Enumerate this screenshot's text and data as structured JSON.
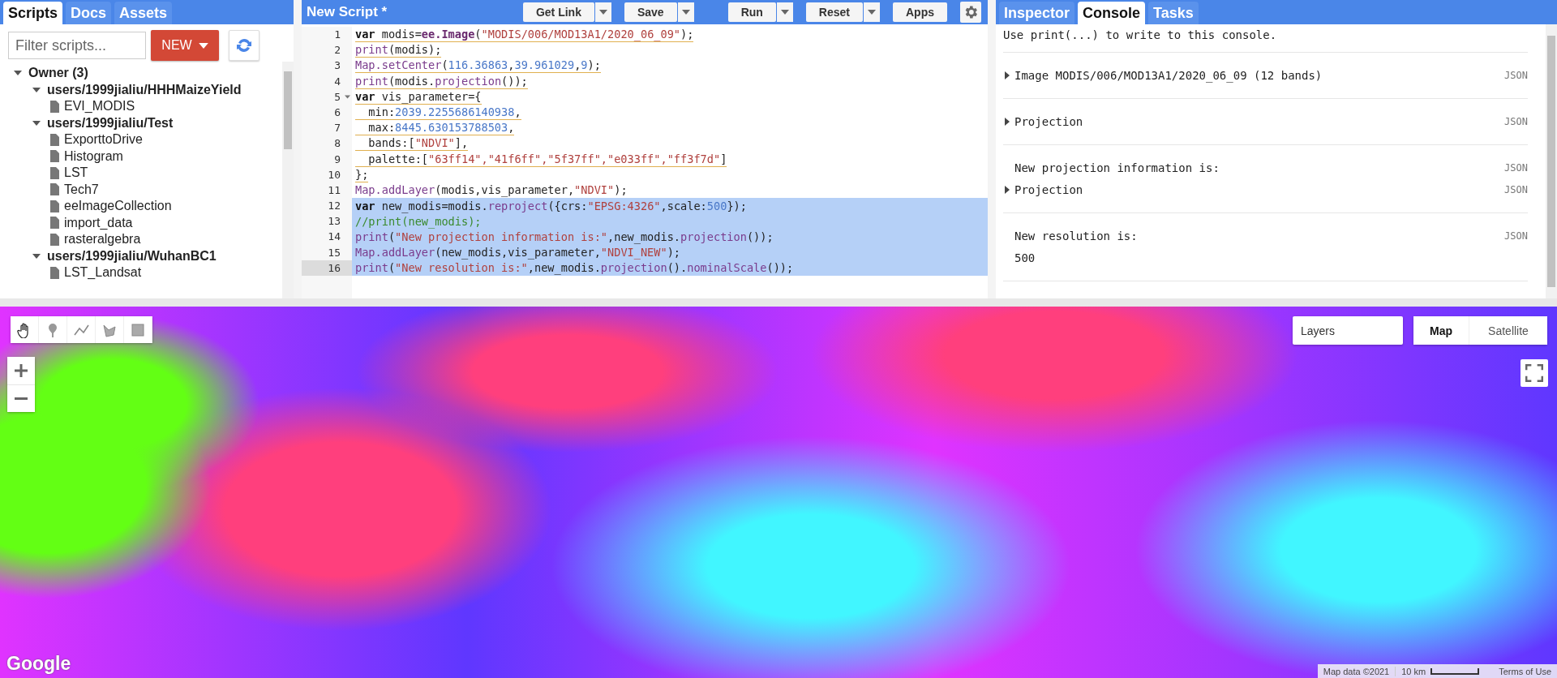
{
  "left_panel": {
    "tabs": [
      {
        "label": "Scripts",
        "selected": true
      },
      {
        "label": "Docs",
        "selected": false
      },
      {
        "label": "Assets",
        "selected": false
      }
    ],
    "filter": {
      "placeholder": "Filter scripts..."
    },
    "new_button": {
      "label": "NEW"
    },
    "tree": [
      {
        "label": "Owner (3)",
        "kind": "group",
        "expanded": true,
        "children": [
          {
            "label": "users/1999jialiu/HHHMaizeYield",
            "kind": "repo",
            "expanded": true,
            "children": [
              {
                "label": "EVI_MODIS",
                "kind": "file"
              }
            ]
          },
          {
            "label": "users/1999jialiu/Test",
            "kind": "repo",
            "expanded": true,
            "children": [
              {
                "label": "ExporttoDrive",
                "kind": "file"
              },
              {
                "label": "Histogram",
                "kind": "file"
              },
              {
                "label": "LST",
                "kind": "file"
              },
              {
                "label": "Tech7",
                "kind": "file"
              },
              {
                "label": "eeImageCollection",
                "kind": "file"
              },
              {
                "label": "import_data",
                "kind": "file"
              },
              {
                "label": "rasteralgebra",
                "kind": "file"
              }
            ]
          },
          {
            "label": "users/1999jialiu/WuhanBC1",
            "kind": "repo",
            "expanded": true,
            "children": [
              {
                "label": "LST_Landsat",
                "kind": "file"
              }
            ]
          }
        ]
      }
    ]
  },
  "editor": {
    "title": "New Script *",
    "buttons": [
      {
        "label": "Get Link",
        "dropdown": true
      },
      {
        "label": "Save",
        "dropdown": true
      },
      {
        "label": "Run",
        "dropdown": true
      },
      {
        "label": "Reset",
        "dropdown": true
      },
      {
        "label": "Apps",
        "dropdown": false
      }
    ],
    "lines": [
      {
        "number": "1",
        "selected": false,
        "current": false,
        "warning": true,
        "fold": false,
        "tokens": [
          {
            "kind": "keyword",
            "text": "var"
          },
          {
            "kind": "plain",
            "text": " modis="
          },
          {
            "kind": "call",
            "text": "ee.Image"
          },
          {
            "kind": "plain",
            "text": "("
          },
          {
            "kind": "string",
            "text": "\"MODIS/006/MOD13A1/2020_06_09\""
          },
          {
            "kind": "plain",
            "text": ");"
          }
        ]
      },
      {
        "number": "2",
        "selected": false,
        "current": false,
        "warning": true,
        "fold": false,
        "tokens": [
          {
            "kind": "func",
            "text": "print"
          },
          {
            "kind": "plain",
            "text": "(modis);"
          }
        ]
      },
      {
        "number": "3",
        "selected": false,
        "current": false,
        "warning": true,
        "fold": false,
        "tokens": [
          {
            "kind": "func",
            "text": "Map.setCenter"
          },
          {
            "kind": "plain",
            "text": "("
          },
          {
            "kind": "number",
            "text": "116.36863"
          },
          {
            "kind": "plain",
            "text": ","
          },
          {
            "kind": "number",
            "text": "39.961029"
          },
          {
            "kind": "plain",
            "text": ","
          },
          {
            "kind": "number",
            "text": "9"
          },
          {
            "kind": "plain",
            "text": ");"
          }
        ]
      },
      {
        "number": "4",
        "selected": false,
        "current": false,
        "warning": true,
        "fold": false,
        "tokens": [
          {
            "kind": "func",
            "text": "print"
          },
          {
            "kind": "plain",
            "text": "(modis."
          },
          {
            "kind": "func",
            "text": "projection"
          },
          {
            "kind": "plain",
            "text": "());"
          }
        ]
      },
      {
        "number": "5",
        "selected": false,
        "current": false,
        "warning": true,
        "fold": true,
        "tokens": [
          {
            "kind": "keyword",
            "text": "var"
          },
          {
            "kind": "plain",
            "text": " vis_parameter={"
          }
        ]
      },
      {
        "number": "6",
        "selected": false,
        "current": false,
        "warning": true,
        "fold": false,
        "tokens": [
          {
            "kind": "plain",
            "text": "  min:"
          },
          {
            "kind": "number",
            "text": "2039.2255686140938"
          },
          {
            "kind": "plain",
            "text": ","
          }
        ]
      },
      {
        "number": "7",
        "selected": false,
        "current": false,
        "warning": true,
        "fold": false,
        "tokens": [
          {
            "kind": "plain",
            "text": "  max:"
          },
          {
            "kind": "number",
            "text": "8445.630153788503"
          },
          {
            "kind": "plain",
            "text": ","
          }
        ]
      },
      {
        "number": "8",
        "selected": false,
        "current": false,
        "warning": true,
        "fold": false,
        "tokens": [
          {
            "kind": "plain",
            "text": "  bands:["
          },
          {
            "kind": "string",
            "text": "\"NDVI\""
          },
          {
            "kind": "plain",
            "text": "],"
          }
        ]
      },
      {
        "number": "9",
        "selected": false,
        "current": false,
        "warning": true,
        "fold": false,
        "tokens": [
          {
            "kind": "plain",
            "text": "  palette:["
          },
          {
            "kind": "string",
            "text": "\"63ff14\",\"41f6ff\",\"5f37ff\",\"e033ff\",\"ff3f7d\""
          },
          {
            "kind": "plain",
            "text": "]"
          }
        ]
      },
      {
        "number": "10",
        "selected": false,
        "current": false,
        "warning": true,
        "fold": false,
        "tokens": [
          {
            "kind": "plain",
            "text": "};"
          }
        ]
      },
      {
        "number": "11",
        "selected": false,
        "current": false,
        "warning": false,
        "fold": false,
        "tokens": [
          {
            "kind": "func",
            "text": "Map.addLayer"
          },
          {
            "kind": "plain",
            "text": "(modis,vis_parameter,"
          },
          {
            "kind": "string",
            "text": "\"NDVI\""
          },
          {
            "kind": "plain",
            "text": ");"
          }
        ]
      },
      {
        "number": "12",
        "selected": true,
        "current": false,
        "warning": false,
        "fold": false,
        "tokens": [
          {
            "kind": "keyword",
            "text": "var"
          },
          {
            "kind": "plain",
            "text": " new_modis=modis."
          },
          {
            "kind": "func",
            "text": "reproject"
          },
          {
            "kind": "plain",
            "text": "({crs:"
          },
          {
            "kind": "string",
            "text": "\"EPSG:4326\""
          },
          {
            "kind": "plain",
            "text": ",scale:"
          },
          {
            "kind": "number",
            "text": "500"
          },
          {
            "kind": "plain",
            "text": "});"
          }
        ]
      },
      {
        "number": "13",
        "selected": true,
        "current": false,
        "warning": false,
        "fold": false,
        "tokens": [
          {
            "kind": "comment",
            "text": "//print(new_modis);"
          }
        ]
      },
      {
        "number": "14",
        "selected": true,
        "current": false,
        "warning": false,
        "fold": false,
        "tokens": [
          {
            "kind": "func",
            "text": "print"
          },
          {
            "kind": "plain",
            "text": "("
          },
          {
            "kind": "string",
            "text": "\"New projection information is:\""
          },
          {
            "kind": "plain",
            "text": ",new_modis."
          },
          {
            "kind": "func",
            "text": "projection"
          },
          {
            "kind": "plain",
            "text": "());"
          }
        ]
      },
      {
        "number": "15",
        "selected": true,
        "current": false,
        "warning": false,
        "fold": false,
        "tokens": [
          {
            "kind": "func",
            "text": "Map.addLayer"
          },
          {
            "kind": "plain",
            "text": "(new_modis,vis_parameter,"
          },
          {
            "kind": "string",
            "text": "\"NDVI_NEW\""
          },
          {
            "kind": "plain",
            "text": ");"
          }
        ]
      },
      {
        "number": "16",
        "selected": true,
        "current": true,
        "warning": false,
        "fold": false,
        "tokens": [
          {
            "kind": "func",
            "text": "print"
          },
          {
            "kind": "plain",
            "text": "("
          },
          {
            "kind": "string",
            "text": "\"New resolution is:\""
          },
          {
            "kind": "plain",
            "text": ",new_modis."
          },
          {
            "kind": "func",
            "text": "projection"
          },
          {
            "kind": "plain",
            "text": "()."
          },
          {
            "kind": "func",
            "text": "nominalScale"
          },
          {
            "kind": "plain",
            "text": "());"
          }
        ]
      }
    ]
  },
  "right_panel": {
    "tabs": [
      {
        "label": "Inspector",
        "selected": false
      },
      {
        "label": "Console",
        "selected": true
      },
      {
        "label": "Tasks",
        "selected": false
      }
    ],
    "hint": "Use print(...) to write to this console.",
    "entries": [
      {
        "rows": [
          {
            "kind": "object",
            "text": "Image MODIS/006/MOD13A1/2020_06_09 (12 bands)",
            "link": "JSON"
          }
        ]
      },
      {
        "rows": [
          {
            "kind": "object",
            "text": "Projection",
            "link": "JSON"
          }
        ]
      },
      {
        "rows": [
          {
            "kind": "text",
            "text": "New projection information is:",
            "link": "JSON"
          },
          {
            "kind": "object",
            "text": "Projection",
            "link": "JSON"
          }
        ]
      },
      {
        "rows": [
          {
            "kind": "text",
            "text": "New resolution is:",
            "link": "JSON"
          },
          {
            "kind": "text",
            "text": "500"
          }
        ]
      }
    ]
  },
  "map": {
    "layers": {
      "label": "Layers"
    },
    "map_types": [
      {
        "label": "Map",
        "selected": true
      },
      {
        "label": "Satellite",
        "selected": false
      }
    ],
    "logo": "Google",
    "attribution": "Map data ©2021",
    "scale": "10 km",
    "terms": "Terms of Use"
  }
}
